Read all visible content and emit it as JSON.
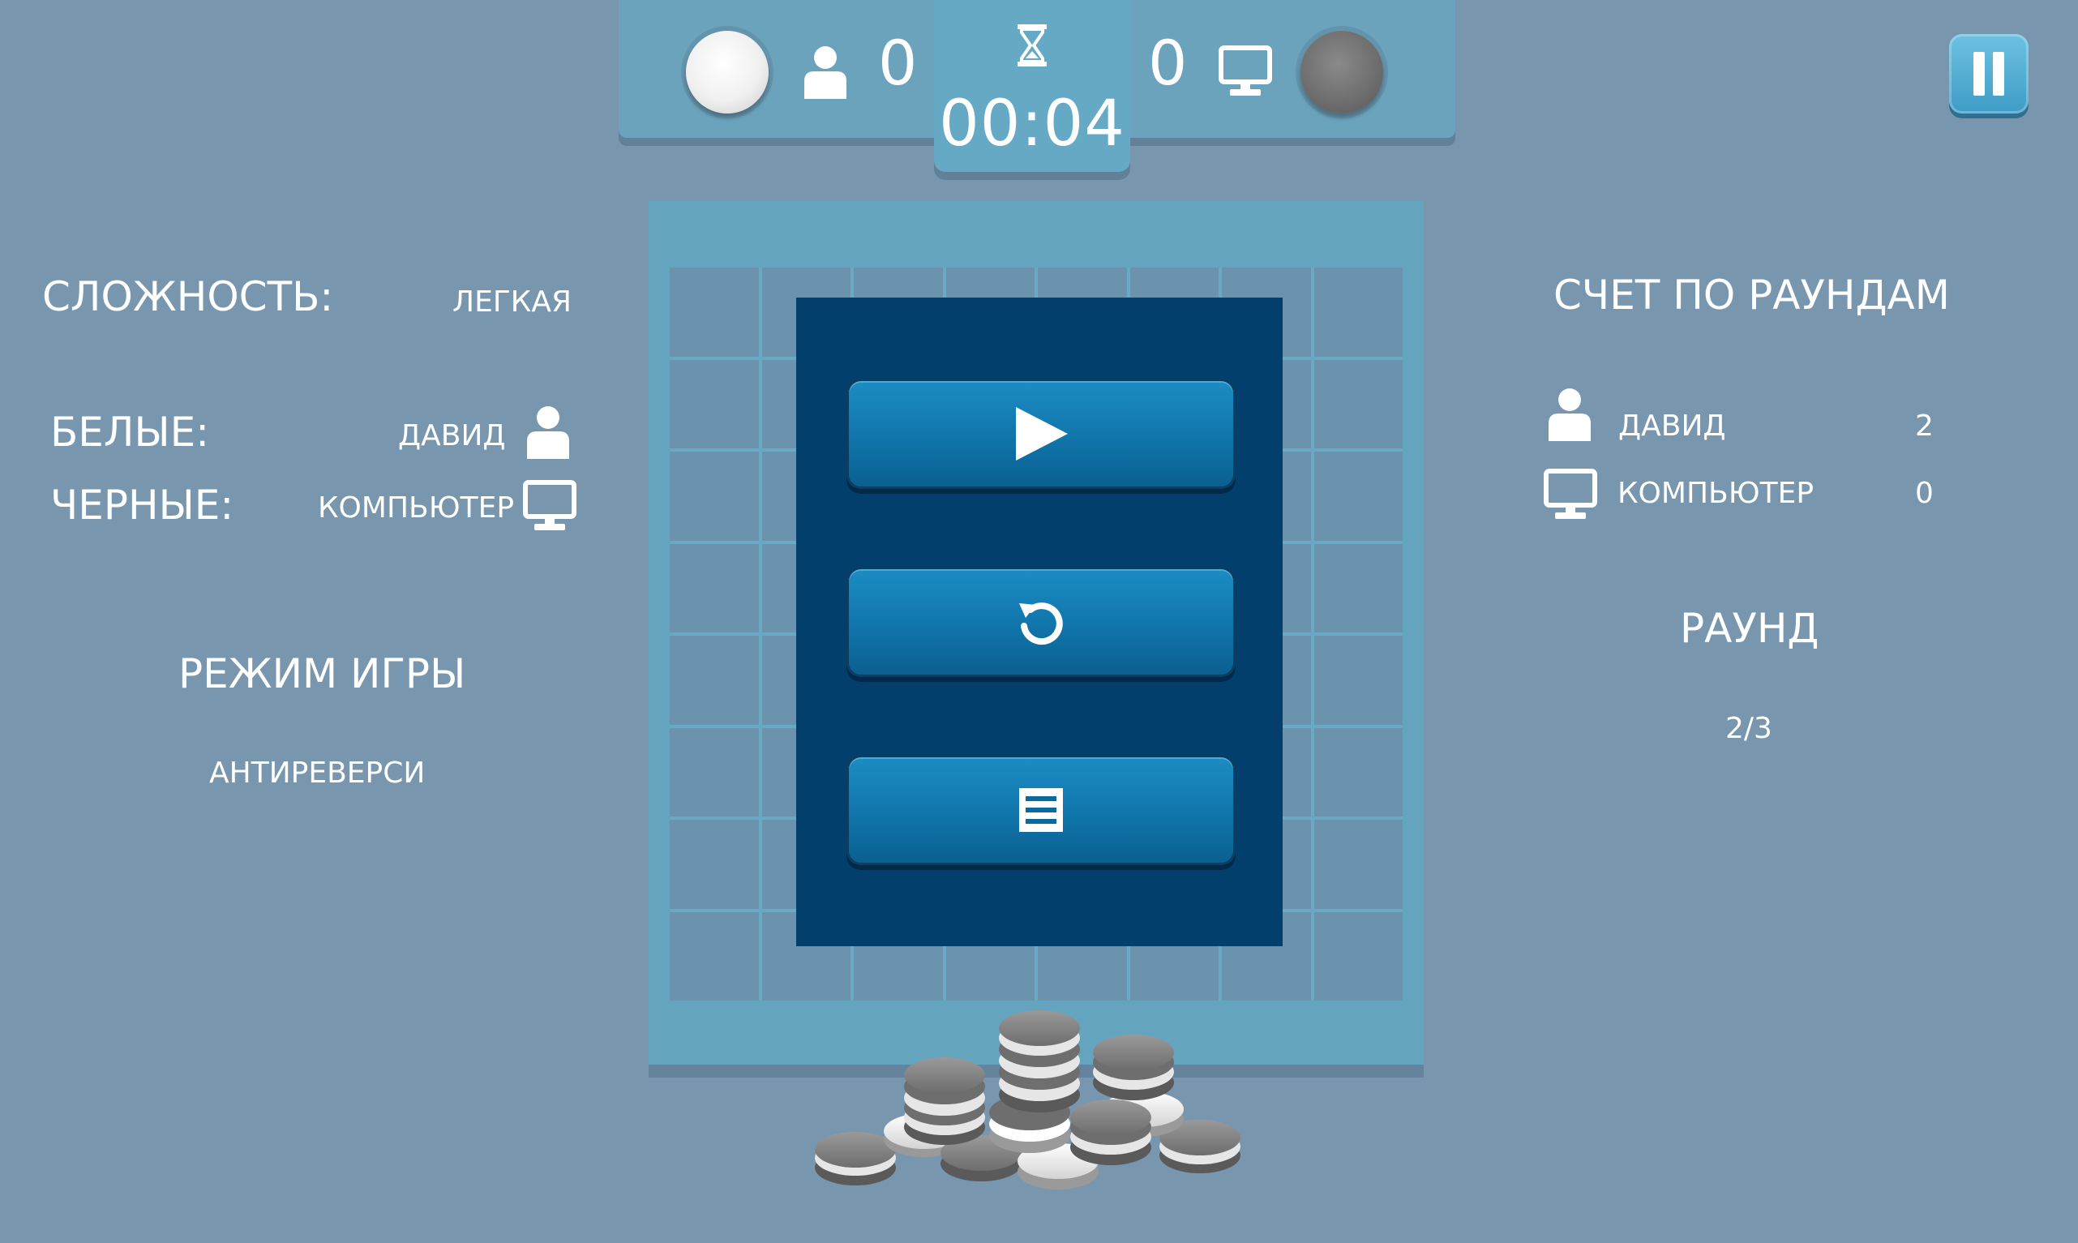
{
  "top_bar": {
    "player_score": "0",
    "computer_score": "0",
    "timer": "00:04"
  },
  "left_panel": {
    "difficulty_label": "СЛОЖНОСТЬ:",
    "difficulty_value": "ЛЕГКАЯ",
    "white_label": "БЕЛЫЕ:",
    "white_value": "ДАВИД",
    "black_label": "ЧЕРНЫЕ:",
    "black_value": "КОМПЬЮТЕР",
    "mode_title": "РЕЖИМ ИГРЫ",
    "mode_value": "АНТИРЕВЕРСИ"
  },
  "right_panel": {
    "title": "СЧЕТ ПО РАУНДАМ",
    "rows": [
      {
        "name": "ДАВИД",
        "score": "2",
        "icon": "user-icon"
      },
      {
        "name": "КОМПЬЮТЕР",
        "score": "0",
        "icon": "computer-icon"
      }
    ],
    "round_title": "РАУНД",
    "round_value": "2/3"
  },
  "menu": {
    "buttons": [
      {
        "name": "play-button",
        "icon": "play-icon"
      },
      {
        "name": "restart-button",
        "icon": "restart-icon"
      },
      {
        "name": "menu-button",
        "icon": "list-icon"
      }
    ]
  },
  "colors": {
    "background": "#7896ae",
    "board_frame": "#64a4be",
    "menu_panel": "#023f6d",
    "button": "#1177ad"
  }
}
